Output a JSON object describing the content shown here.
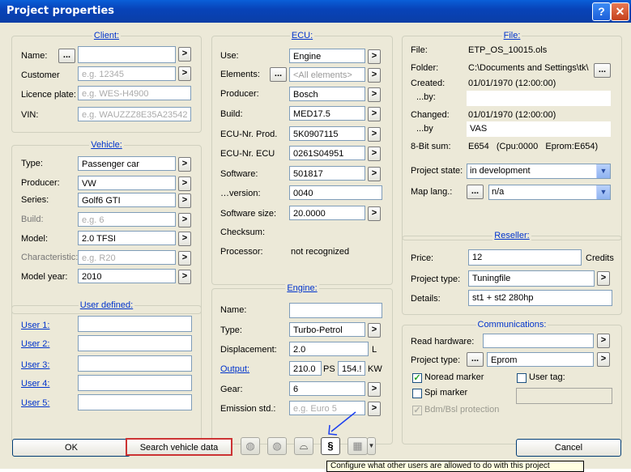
{
  "window": {
    "title": "Project properties",
    "help_label": "?",
    "close_label": "✕"
  },
  "client": {
    "legend": "Client:",
    "name_label": "Name:",
    "name_value": "",
    "customer_label": "Customer",
    "customer_ph": "e.g. 12345",
    "plate_label": "Licence plate:",
    "plate_ph": "e.g. WES-H4900",
    "vin_label": "VIN:",
    "vin_ph": "e.g. WAUZZZ8E35A23542"
  },
  "vehicle": {
    "legend": "Vehicle:",
    "type_label": "Type:",
    "type_value": "Passenger car",
    "producer_label": "Producer:",
    "producer_value": "VW",
    "series_label": "Series:",
    "series_value": "Golf6 GTI",
    "build_label": "Build:",
    "build_ph": "e.g. 6",
    "model_label": "Model:",
    "model_value": "2.0 TFSI",
    "char_label": "Characteristic:",
    "char_ph": "e.g. R20",
    "year_label": "Model year:",
    "year_value": "2010"
  },
  "user_defined": {
    "legend": "User defined:",
    "items": [
      "User 1:",
      "User 2:",
      "User 3:",
      "User 4:",
      "User 5:"
    ]
  },
  "ecu": {
    "legend": "ECU:",
    "use_label": "Use:",
    "use_value": "Engine",
    "elements_label": "Elements:",
    "elements_value": "<All elements>",
    "producer_label": "Producer:",
    "producer_value": "Bosch",
    "build_label": "Build:",
    "build_value": "MED17.5",
    "prod_label": "ECU-Nr. Prod.",
    "prod_value": "5K0907115",
    "ecunr_label": "ECU-Nr. ECU",
    "ecunr_value": "0261S04951",
    "software_label": "Software:",
    "software_value": "501817",
    "version_label": "…version:",
    "version_value": "0040",
    "swsize_label": "Software size:",
    "swsize_value": "20.0000",
    "checksum_label": "Checksum:",
    "processor_label": "Processor:",
    "processor_value": "not recognized"
  },
  "engine": {
    "legend": "Engine:",
    "name_label": "Name:",
    "name_value": "",
    "type_label": "Type:",
    "type_value": "Turbo-Petrol",
    "disp_label": "Displacement:",
    "disp_value": "2.0",
    "disp_unit": "L",
    "output_label": "Output:",
    "ps_value": "210.0",
    "ps_unit": "PS",
    "kw_value": "154.!",
    "kw_unit": "KW",
    "gear_label": "Gear:",
    "gear_value": "6",
    "emission_label": "Emission std.:",
    "emission_ph": "e.g. Euro 5"
  },
  "file": {
    "legend": "File:",
    "file_label": "File:",
    "file_value": "ETP_OS_10015.ols",
    "folder_label": "Folder:",
    "folder_value": "C:\\Documents and Settings\\tk\\",
    "created_label": "Created:",
    "created_value": "01/01/1970 (12:00:00)",
    "by1_label": "...by:",
    "by1_value": "",
    "changed_label": "Changed:",
    "changed_value": "01/01/1970 (12:00:00)",
    "by2_label": "...by",
    "by2_value": "VAS",
    "sum_label": "8-Bit sum:",
    "sum_value": "E654   (Cpu:0000   Eprom:E654)",
    "state_label": "Project state:",
    "state_value": "in development",
    "maplang_label": "Map lang.:",
    "maplang_value": "n/a"
  },
  "reseller": {
    "legend": "Reseller:",
    "price_label": "Price:",
    "price_value": "12",
    "price_unit": "Credits",
    "ptype_label": "Project type:",
    "ptype_value": "Tuningfile",
    "details_label": "Details:",
    "details_value": "st1 + st2 280hp"
  },
  "comms": {
    "legend": "Communications:",
    "read_label": "Read hardware:",
    "read_value": "",
    "ptype_label": "Project type:",
    "ptype_value": "Eprom",
    "noread_label": "Noread marker",
    "noread_checked": true,
    "usertag_label": "User tag:",
    "usertag_checked": false,
    "spi_label": "Spi marker",
    "spi_checked": false,
    "bdm_label": "Bdm/Bsl protection",
    "bdm_checked": true
  },
  "footer": {
    "ok_label": "OK",
    "search_label": "Search vehicle data",
    "cancel_label": "Cancel",
    "paragraph_label": "§",
    "tooltip": "Configure what other users are allowed to do with this project"
  },
  "colors": {
    "title_bar": "#0a4fd0",
    "link": "#0033cc",
    "annotation_arrow": "#1b3ff0",
    "search_border": "#cc0000"
  }
}
